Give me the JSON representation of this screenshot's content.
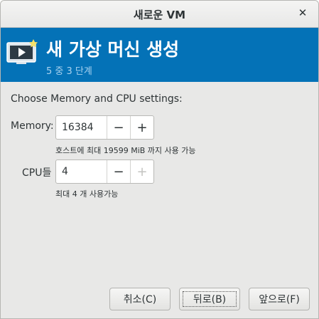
{
  "window": {
    "title": "새로운 VM",
    "close_glyph": "✕"
  },
  "banner": {
    "heading": "새 가상 머신 생성",
    "step": "5 중 3 단계",
    "icon": "vm-monitor-icon"
  },
  "content": {
    "section_label": "Choose Memory and CPU settings:",
    "memory": {
      "label": "Memory:",
      "value": "16384",
      "hint": "호스트에 최대 19599 MiB 까지 사용 가능"
    },
    "cpu": {
      "label": "CPU들",
      "value": "4",
      "hint": "최대 4 개 사용가능"
    },
    "minus_glyph": "−",
    "plus_glyph": "+"
  },
  "footer": {
    "cancel": "취소(C)",
    "back": "뒤로(B)",
    "forward": "앞으로(F)"
  },
  "colors": {
    "banner": "#0472b7",
    "step_text": "#a9d2ef"
  }
}
